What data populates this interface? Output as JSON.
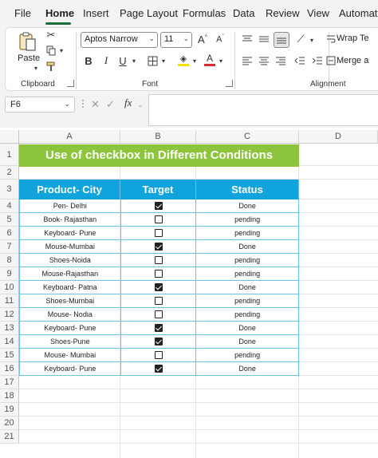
{
  "menu": {
    "items": [
      "File",
      "Home",
      "Insert",
      "Page Layout",
      "Formulas",
      "Data",
      "Review",
      "View",
      "Automate"
    ],
    "active": "Home"
  },
  "ribbon": {
    "clipboard": {
      "label": "Clipboard",
      "paste_label": "Paste"
    },
    "font": {
      "label": "Font",
      "family": "Aptos Narrow",
      "size": "11"
    },
    "alignment": {
      "label": "Alignment",
      "wrap_text": "Wrap Te",
      "merge": "Merge a"
    }
  },
  "formula_bar": {
    "name_box": "F6",
    "fx": "fx",
    "formula": ""
  },
  "columns": [
    "A",
    "B",
    "C",
    "D"
  ],
  "rows": [
    "1",
    "2",
    "3",
    "4",
    "5",
    "6",
    "7",
    "8",
    "9",
    "10",
    "11",
    "12",
    "13",
    "14",
    "15",
    "16",
    "17",
    "18",
    "19",
    "20",
    "21"
  ],
  "sheet": {
    "title": "Use of checkbox in Different Conditions",
    "headers": [
      "Product- City",
      "Target",
      "Status"
    ],
    "records": [
      {
        "product": "Pen- Delhi",
        "checked": true,
        "status": "Done"
      },
      {
        "product": "Book- Rajasthan",
        "checked": false,
        "status": "pending"
      },
      {
        "product": "Keyboard- Pune",
        "checked": false,
        "status": "pending"
      },
      {
        "product": "Mouse-Mumbai",
        "checked": true,
        "status": "Done"
      },
      {
        "product": "Shoes-Noida",
        "checked": false,
        "status": "pending"
      },
      {
        "product": "Mouse-Rajasthan",
        "checked": false,
        "status": "pending"
      },
      {
        "product": "Keyboard- Patna",
        "checked": true,
        "status": "Done"
      },
      {
        "product": "Shoes-Mumbai",
        "checked": false,
        "status": "pending"
      },
      {
        "product": "Mouse- Nodia",
        "checked": false,
        "status": "pending"
      },
      {
        "product": "Keyboard- Pune",
        "checked": true,
        "status": "Done"
      },
      {
        "product": "Shoes-Pune",
        "checked": true,
        "status": "Done"
      },
      {
        "product": "Mouse- Mumbai",
        "checked": false,
        "status": "pending"
      },
      {
        "product": "Keyboard- Pune",
        "checked": true,
        "status": "Done"
      }
    ]
  },
  "colors": {
    "title_fill": "#8cc43c",
    "header_fill": "#11a3dc",
    "ribbon_accent": "#1a6e3c"
  }
}
